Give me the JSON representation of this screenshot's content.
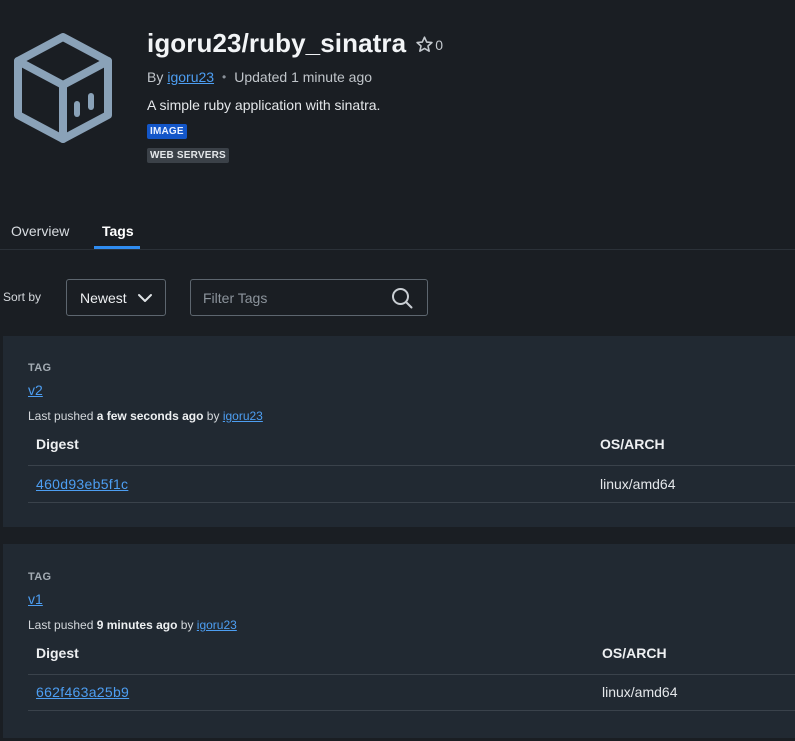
{
  "header": {
    "icon": "package-box-icon",
    "repo_title": "igoru23/ruby_sinatra",
    "star_icon": "star-outline-icon",
    "star_count": "0",
    "by_label": "By",
    "owner": "igoru23",
    "updated": "Updated 1 minute ago",
    "description": "A simple ruby application with sinatra.",
    "badges": [
      "IMAGE",
      "WEB SERVERS"
    ]
  },
  "tabs": {
    "overview": "Overview",
    "tags": "Tags",
    "active": "Tags"
  },
  "controls": {
    "sort_label": "Sort by",
    "sort_value": "Newest",
    "filter_placeholder": "Filter Tags",
    "filter_value": ""
  },
  "tags": [
    {
      "section_label": "TAG",
      "name": "v2",
      "pushed_prefix": "Last pushed",
      "pushed_time": "a few seconds ago",
      "pushed_by": "by",
      "pusher": "igoru23",
      "digest_header": "Digest",
      "os_header": "OS/ARCH",
      "digest": "460d93eb5f1c",
      "os_arch": "linux/amd64"
    },
    {
      "section_label": "TAG",
      "name": "v1",
      "pushed_prefix": "Last pushed",
      "pushed_time": "9 minutes ago",
      "pushed_by": "by",
      "pusher": "igoru23",
      "digest_header": "Digest",
      "os_header": "OS/ARCH",
      "digest": "662f463a25b9",
      "os_arch": "linux/amd64"
    }
  ],
  "colors": {
    "background": "#1a1e23",
    "card": "#212932",
    "link": "#4d9ef2",
    "tab_accent": "#2f8cf0",
    "badge_image": "#1356c8",
    "badge_web": "#3b4148",
    "logo": "#8aa2b8"
  }
}
